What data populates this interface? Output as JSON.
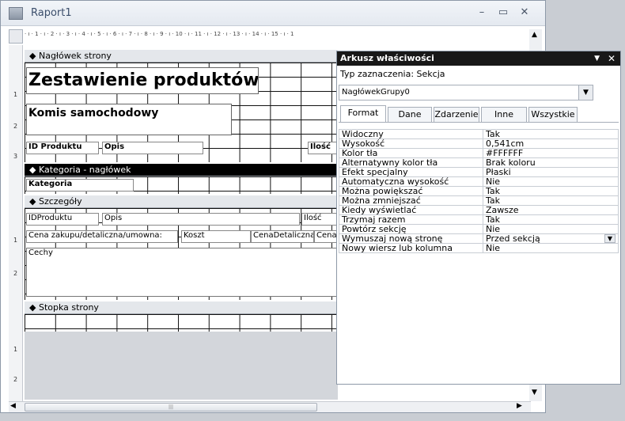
{
  "window": {
    "title": "Raport1"
  },
  "ruler": {
    "marks": "· ı · 1 · ı · 2 · ı · 3 · ı · 4 · ı · 5 · ı · 6 · ı · 7 · ı · 8 · ı · 9 · ı · 10 · ı · 11 · ı · 12 · ı · 13 · ı · 14 · ı · 15 · ı · 1"
  },
  "vruler": [
    "1",
    "2",
    "3",
    "1",
    "2",
    "1",
    "2"
  ],
  "sections": {
    "page_header": {
      "label": "Nagłówek strony"
    },
    "category_header": {
      "label": "Kategoria - nagłówek"
    },
    "details": {
      "label": "Szczegóły"
    },
    "page_footer": {
      "label": "Stopka strony"
    }
  },
  "controls": {
    "report_title": "Zestawienie produktów",
    "subtitle": "Komis samochodowy",
    "lbl_id": "ID Produktu",
    "lbl_opis": "Opis",
    "lbl_ilosc": "Ilość",
    "category": "Kategoria",
    "txt_id": "IDProduktu",
    "txt_opis": "Opis",
    "txt_ilosc": "Ilość",
    "lbl_cena": "Cena zakupu/detaliczna/umowna:",
    "txt_koszt": "Koszt",
    "txt_cena_det": "CenaDetaliczna",
    "txt_cena": "Cena",
    "txt_cechy": "Cechy"
  },
  "property_sheet": {
    "title": "Arkusz właściwości",
    "selection_type": "Typ zaznaczenia:  Sekcja",
    "selected_object": "NagłówekGrupy0",
    "tabs": [
      "Format",
      "Dane",
      "Zdarzenie",
      "Inne",
      "Wszystkie"
    ],
    "active_tab": "Format",
    "rows": [
      {
        "name": "Widoczny",
        "value": "Tak"
      },
      {
        "name": "Wysokość",
        "value": "0,541cm"
      },
      {
        "name": "Kolor tła",
        "value": "#FFFFFF"
      },
      {
        "name": "Alternatywny kolor tła",
        "value": "Brak koloru"
      },
      {
        "name": "Efekt specjalny",
        "value": "Płaski"
      },
      {
        "name": "Automatyczna wysokość",
        "value": "Nie"
      },
      {
        "name": "Można powiększać",
        "value": "Tak"
      },
      {
        "name": "Można zmniejszać",
        "value": "Tak"
      },
      {
        "name": "Kiedy wyświetlać",
        "value": "Zawsze"
      },
      {
        "name": "Trzymaj razem",
        "value": "Tak"
      },
      {
        "name": "Powtórz sekcję",
        "value": "Nie"
      },
      {
        "name": "Wymuszaj nową stronę",
        "value": "Przed sekcją"
      },
      {
        "name": "Nowy wiersz lub kolumna",
        "value": "Nie"
      }
    ]
  },
  "colors": {
    "section_dark": "#000000",
    "section_light": "#e4e7eb",
    "accent": "#3b4e6b"
  }
}
